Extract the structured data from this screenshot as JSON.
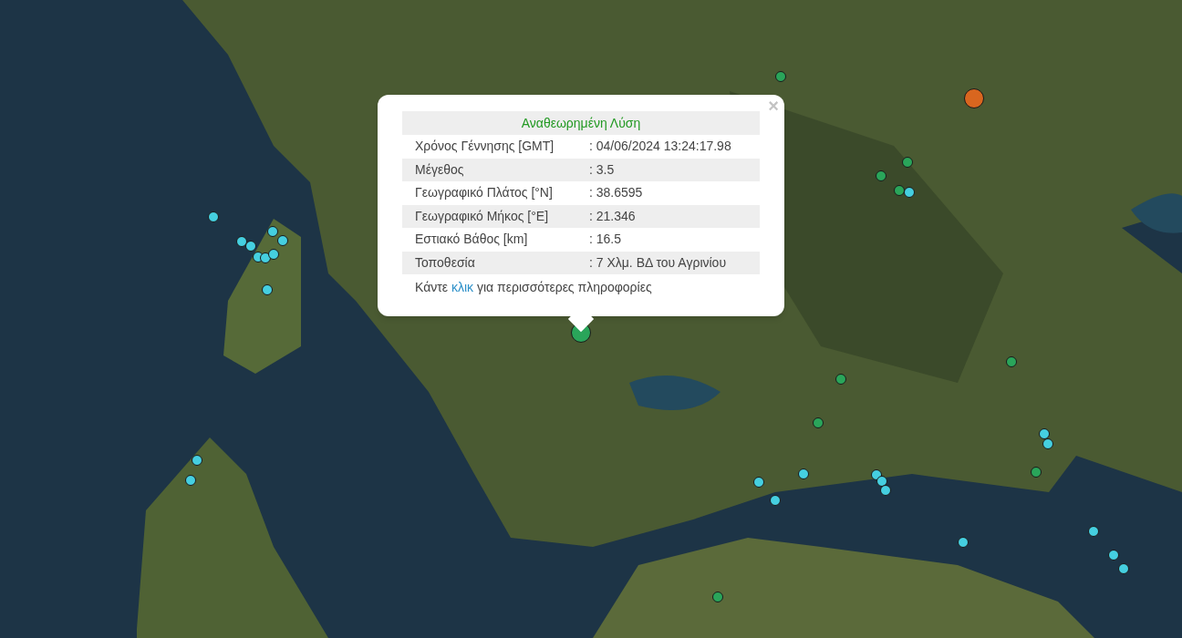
{
  "popup": {
    "title": "Αναθεωρημένη Λύση",
    "close": "×",
    "rows": [
      {
        "label": "Χρόνος Γέννησης [GMT]",
        "value": ": 04/06/2024 13:24:17.98"
      },
      {
        "label": "Μέγεθος",
        "value": ": 3.5"
      },
      {
        "label": "Γεωγραφικό Πλάτος [°N]",
        "value": ": 38.6595"
      },
      {
        "label": "Γεωγραφικό Μήκος [°E]",
        "value": ": 21.346"
      },
      {
        "label": "Εστιακό Βάθος [km]",
        "value": ": 16.5"
      },
      {
        "label": "Τοποθεσία",
        "value": ": 7 Χλμ. ΒΔ του Αγρινίου"
      }
    ],
    "footer": {
      "before": "Κάντε",
      "link": "κλικ",
      "after": "για περισσότερες πληροφορίες"
    }
  },
  "markers": [
    {
      "kind": "large",
      "color": "#2aa55a"
    },
    {
      "kind": "large",
      "color": "#d9661f"
    },
    {
      "kind": "small",
      "color": "#45cfe0"
    },
    {
      "kind": "small",
      "color": "#45cfe0"
    },
    {
      "kind": "small",
      "color": "#45cfe0"
    },
    {
      "kind": "small",
      "color": "#45cfe0"
    },
    {
      "kind": "small",
      "color": "#45cfe0"
    },
    {
      "kind": "small",
      "color": "#45cfe0"
    },
    {
      "kind": "small",
      "color": "#45cfe0"
    },
    {
      "kind": "small",
      "color": "#45cfe0"
    },
    {
      "kind": "small",
      "color": "#45cfe0"
    },
    {
      "kind": "small",
      "color": "#45cfe0"
    },
    {
      "kind": "small",
      "color": "#45cfe0"
    },
    {
      "kind": "small",
      "color": "#45cfe0"
    },
    {
      "kind": "small",
      "color": "#45cfe0"
    },
    {
      "kind": "small",
      "color": "#45cfe0"
    },
    {
      "kind": "small",
      "color": "#45cfe0"
    },
    {
      "kind": "small",
      "color": "#45cfe0"
    },
    {
      "kind": "small",
      "color": "#45cfe0"
    },
    {
      "kind": "small",
      "color": "#45cfe0"
    },
    {
      "kind": "small",
      "color": "#45cfe0"
    },
    {
      "kind": "small",
      "color": "#45cfe0"
    },
    {
      "kind": "small",
      "color": "#45cfe0"
    },
    {
      "kind": "small",
      "color": "#45cfe0"
    },
    {
      "kind": "small",
      "color": "#45cfe0"
    },
    {
      "kind": "small",
      "color": "#45cfe0"
    },
    {
      "kind": "small",
      "color": "#2aa55a"
    },
    {
      "kind": "small",
      "color": "#2aa55a"
    },
    {
      "kind": "small",
      "color": "#2aa55a"
    },
    {
      "kind": "small",
      "color": "#2aa55a"
    },
    {
      "kind": "small",
      "color": "#2aa55a"
    },
    {
      "kind": "small",
      "color": "#2aa55a"
    },
    {
      "kind": "small",
      "color": "#2aa55a"
    },
    {
      "kind": "small",
      "color": "#2aa55a"
    },
    {
      "kind": "small",
      "color": "#2aa55a"
    }
  ]
}
